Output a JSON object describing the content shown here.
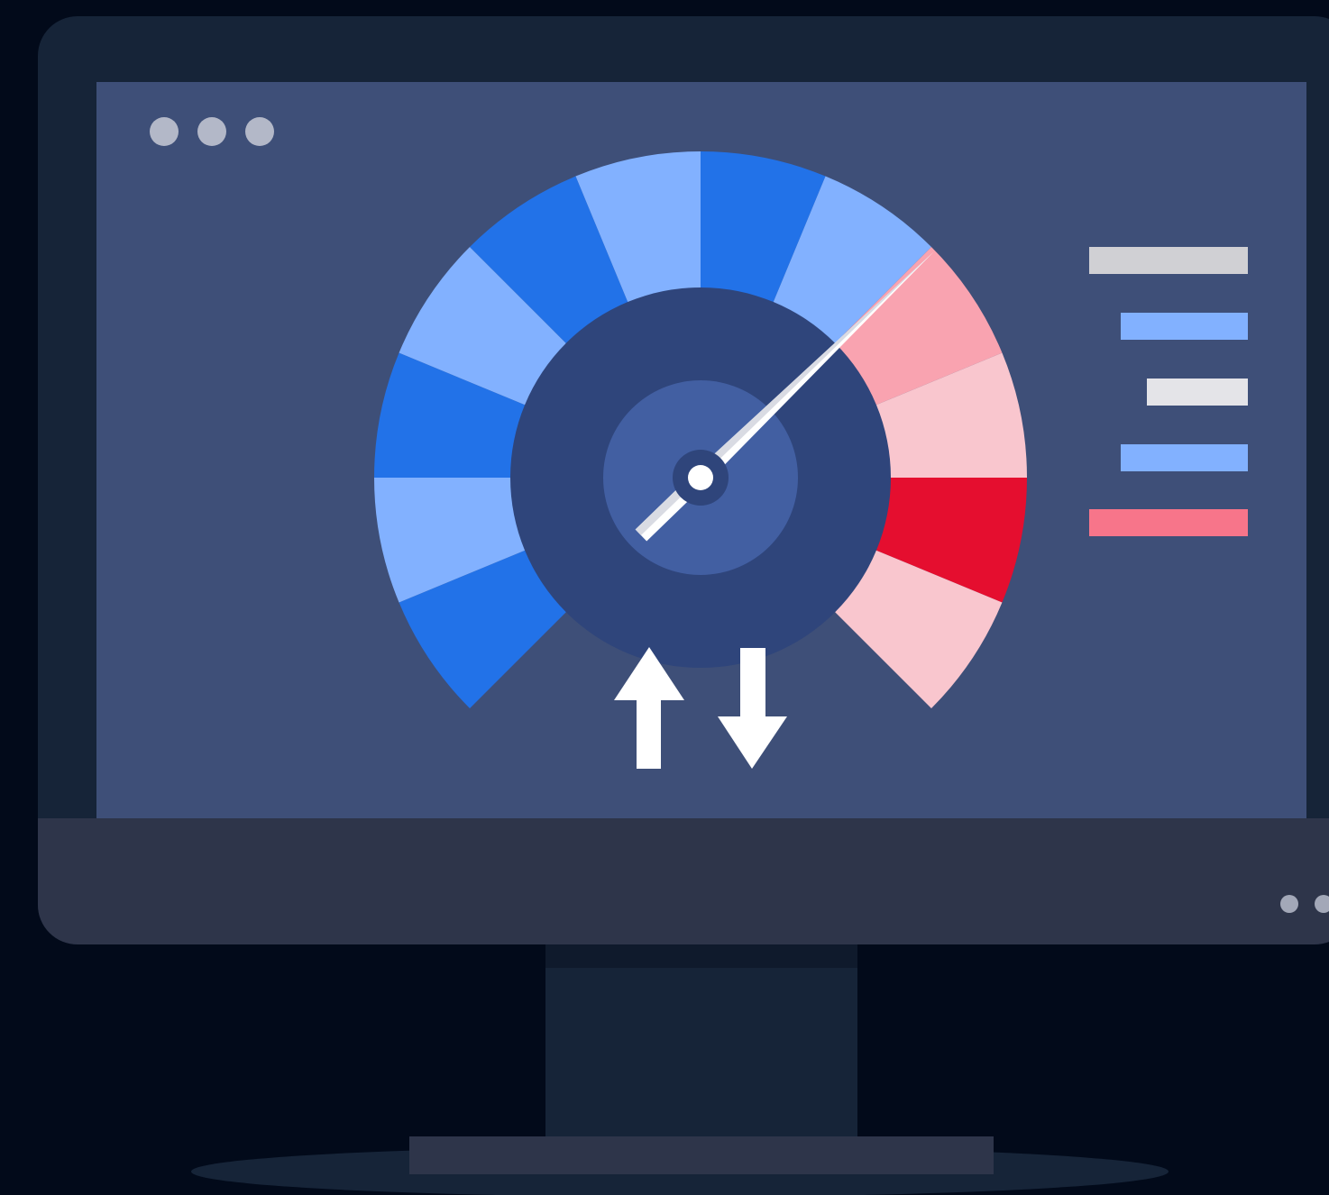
{
  "colors": {
    "background": "#020a1a",
    "monitor_frame": "#162438",
    "monitor_chin": "#2e354a",
    "screen": "#3e4f78",
    "gauge_blue_dark": "#2272e8",
    "gauge_blue_light": "#82b1ff",
    "gauge_pink_medium": "#f9a3b0",
    "gauge_pink_light": "#f9c6ce",
    "gauge_red": "#e50e2f",
    "gauge_inner_ring": "#2f457b",
    "gauge_hub": "#425fa2",
    "needle": "#ffffff",
    "arrows": "#ffffff"
  },
  "gauge": {
    "segments": [
      {
        "color": "#2272e8"
      },
      {
        "color": "#82b1ff"
      },
      {
        "color": "#2272e8"
      },
      {
        "color": "#82b1ff"
      },
      {
        "color": "#2272e8"
      },
      {
        "color": "#82b1ff"
      },
      {
        "color": "#2272e8"
      },
      {
        "color": "#82b1ff"
      },
      {
        "color": "#f9a3b0"
      },
      {
        "color": "#f9c6ce"
      },
      {
        "color": "#e50e2f"
      },
      {
        "color": "#f9c6ce"
      }
    ],
    "needle_level": 0.67
  },
  "legend": [
    {
      "color": "#d0d0d4"
    },
    {
      "color": "#82b1ff"
    },
    {
      "color": "#e4e4e8"
    },
    {
      "color": "#82b1ff"
    },
    {
      "color": "#f7758a"
    }
  ],
  "icons": {
    "upload": "arrow-up-icon",
    "download": "arrow-down-icon"
  }
}
